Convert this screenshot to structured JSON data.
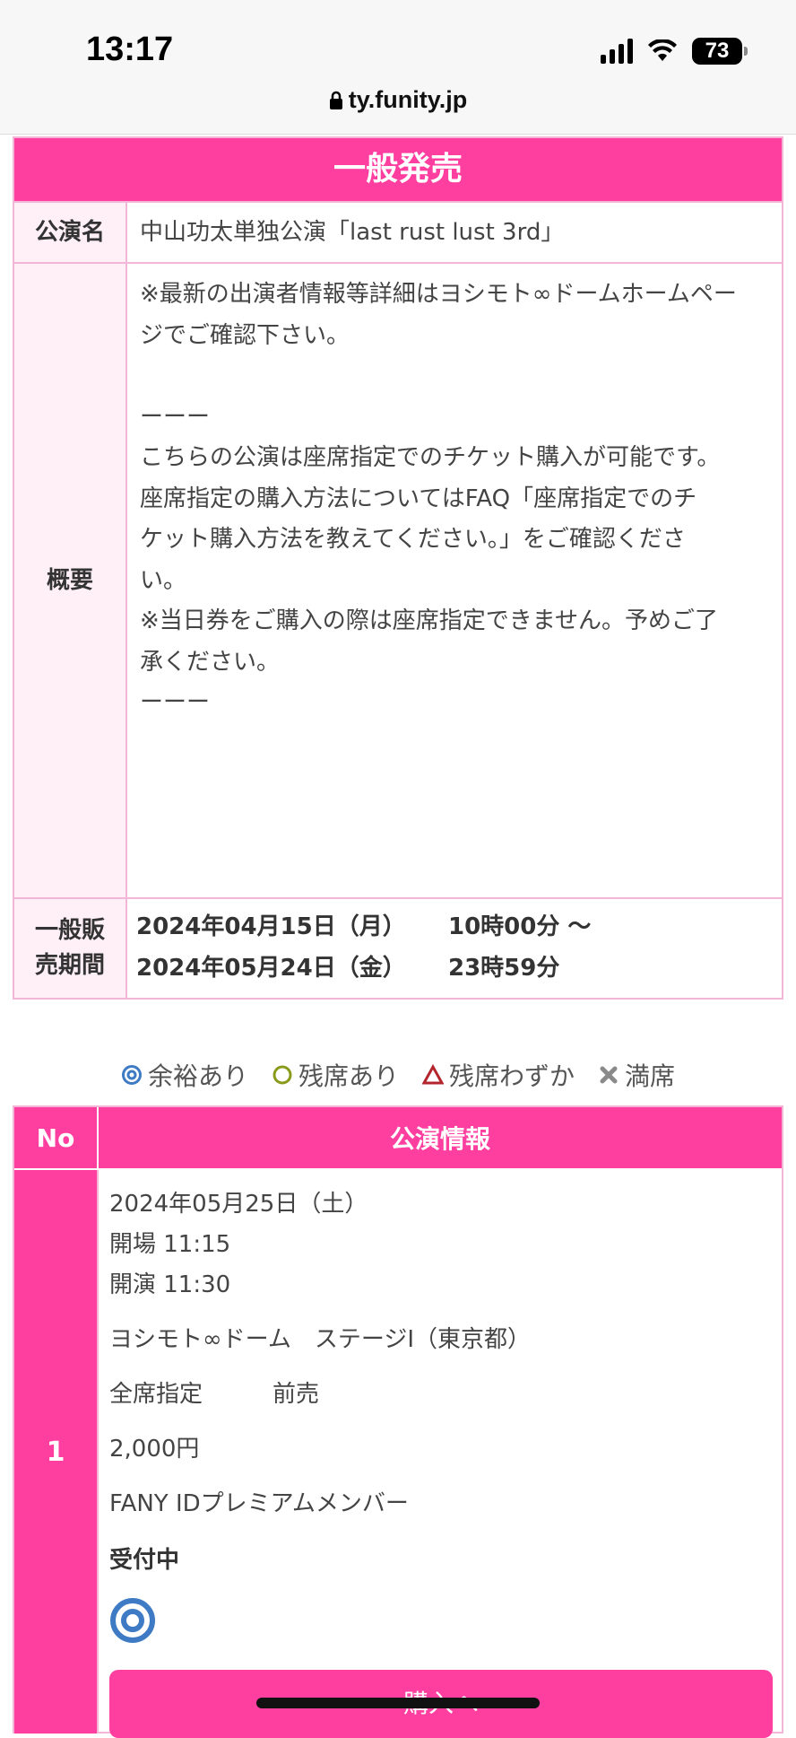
{
  "status_bar": {
    "time": "13:17",
    "battery": "73"
  },
  "browser": {
    "url": "ty.funity.jp"
  },
  "info_table": {
    "header": "一般発売",
    "name_label": "公演名",
    "name_value": "中山功太単独公演「last rust lust 3rd」",
    "summary_label": "概要",
    "summary_lines": [
      "※最新の出演者情報等詳細はヨシモト∞ドームホームペー",
      "ジでご確認下さい。",
      "",
      "ーーー",
      "こちらの公演は座席指定でのチケット購入が可能です。",
      "座席指定の購入方法についてはFAQ「座席指定でのチ",
      "ケット購入方法を教えてください。」をご確認くださ",
      "い。",
      "※当日券をご購入の際は座席指定できません。予めご了",
      "承ください。",
      "ーーー"
    ],
    "period_label": "一般販売期間",
    "period_start_date": "2024年04月15日（月）",
    "period_start_time": "10時00分 〜",
    "period_end_date": "2024年05月24日（金）",
    "period_end_time": "23時59分"
  },
  "legend": {
    "ample": "余裕あり",
    "available": "残席あり",
    "few": "残席わずか",
    "full": "満席"
  },
  "performance_table": {
    "col_no": "No",
    "col_info": "公演情報",
    "rows": [
      {
        "no": "1",
        "date": "2024年05月25日（土）",
        "open": "開場 11:15",
        "start": "開演 11:30",
        "venue": "ヨシモト∞ドーム　ステージⅠ（東京都）",
        "seat_type": "全席指定　　　前売",
        "price": "2,000円",
        "member": "FANY IDプレミアムメンバー",
        "status": "受付中",
        "availability_icon": "double-circle-icon",
        "buy_label": "購入へ"
      }
    ]
  },
  "colors": {
    "accent": "#ff3fa0",
    "border": "#f4b6d6",
    "label_bg": "#fff0f7"
  }
}
